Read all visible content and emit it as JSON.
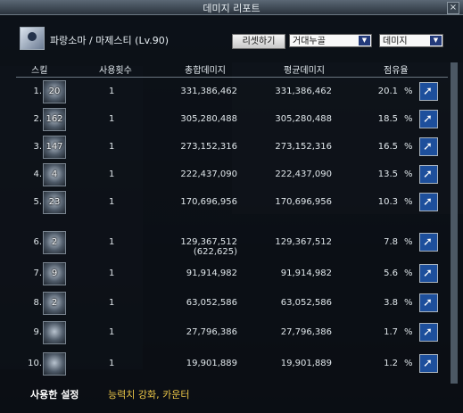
{
  "window": {
    "title": "데미지 리포트",
    "close_label": "×"
  },
  "character": {
    "name": "파랑소마 / 마제스티 (Lv.90)"
  },
  "toolbar": {
    "reset_label": "리셋하기",
    "sort_select": "거대누골",
    "mode_select": "데미지",
    "arrow": "▼"
  },
  "columns": {
    "skill": "스킬",
    "uses": "사용횟수",
    "total": "총합데미지",
    "avg": "평균데미지",
    "share": "점유율"
  },
  "rows": [
    {
      "no": "1.",
      "lvl": "20",
      "count": "1",
      "total": "331,386,462",
      "total2": "",
      "avg": "331,386,462",
      "pct": "20.1",
      "sign": "%"
    },
    {
      "no": "2.",
      "lvl": "162",
      "count": "1",
      "total": "305,280,488",
      "total2": "",
      "avg": "305,280,488",
      "pct": "18.5",
      "sign": "%"
    },
    {
      "no": "3.",
      "lvl": "147",
      "count": "1",
      "total": "273,152,316",
      "total2": "",
      "avg": "273,152,316",
      "pct": "16.5",
      "sign": "%"
    },
    {
      "no": "4.",
      "lvl": "4",
      "count": "1",
      "total": "222,437,090",
      "total2": "",
      "avg": "222,437,090",
      "pct": "13.5",
      "sign": "%"
    },
    {
      "no": "5.",
      "lvl": "23",
      "count": "1",
      "total": "170,696,956",
      "total2": "",
      "avg": "170,696,956",
      "pct": "10.3",
      "sign": "%"
    },
    {
      "no": "6.",
      "lvl": "2",
      "count": "1",
      "total": "129,367,512",
      "total2": "(622,625)",
      "avg": "129,367,512",
      "pct": "7.8",
      "sign": "%"
    },
    {
      "no": "7.",
      "lvl": "9",
      "count": "1",
      "total": "91,914,982",
      "total2": "",
      "avg": "91,914,982",
      "pct": "5.6",
      "sign": "%"
    },
    {
      "no": "8.",
      "lvl": "2",
      "count": "1",
      "total": "63,052,586",
      "total2": "",
      "avg": "63,052,586",
      "pct": "3.8",
      "sign": "%"
    },
    {
      "no": "9.",
      "lvl": "",
      "count": "1",
      "total": "27,796,386",
      "total2": "",
      "avg": "27,796,386",
      "pct": "1.7",
      "sign": "%"
    },
    {
      "no": "10.",
      "lvl": "",
      "count": "1",
      "total": "19,901,889",
      "total2": "",
      "avg": "19,901,889",
      "pct": "1.2",
      "sign": "%"
    }
  ],
  "bottom": {
    "used_label": "사용한 설정",
    "used_detail": "능력치 강화, 카운터"
  }
}
